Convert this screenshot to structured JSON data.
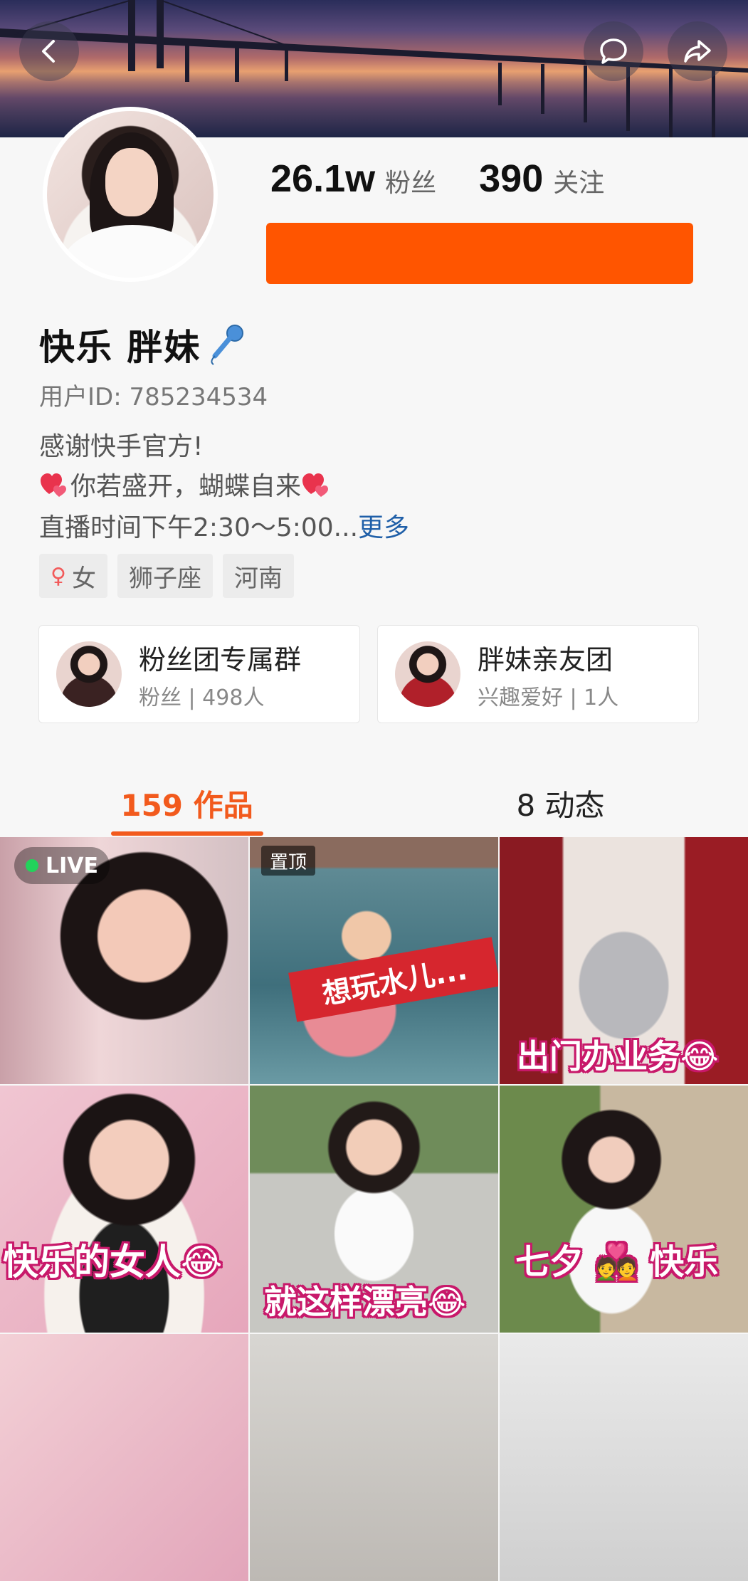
{
  "header": {
    "back_icon": "back-arrow-icon",
    "comment_icon": "speech-bubble-icon",
    "share_icon": "share-arrow-icon"
  },
  "stats": {
    "fans_value": "26.1w",
    "fans_label": "粉丝",
    "following_value": "390",
    "following_label": "关注"
  },
  "profile": {
    "name": "快乐 胖妹",
    "name_emoji": "microphone-icon",
    "user_id": "用户ID: 785234534",
    "bio_line1": "感谢快手官方!",
    "bio_line2": "你若盛开，蝴蝶自来",
    "bio_line3": "直播时间下午2:30～5:00...",
    "bio_more": "更多"
  },
  "tags": [
    {
      "label": "女",
      "icon": "female-icon"
    },
    {
      "label": "狮子座"
    },
    {
      "label": "河南"
    }
  ],
  "groups": [
    {
      "title": "粉丝团专属群",
      "subtitle": "粉丝 | 498人"
    },
    {
      "title": "胖妹亲友团",
      "subtitle": "兴趣爱好 | 1人"
    }
  ],
  "tabs": {
    "works": "159 作品",
    "moments": "8 动态"
  },
  "grid": {
    "live_badge": "LIVE",
    "pinned_badge": "置顶",
    "caption_2": "想玩水儿...",
    "caption_3": "出门办业务😂",
    "caption_4": "快乐的女人😂",
    "caption_5": "就这样漂亮😂",
    "caption_6": "七夕 💑 快乐"
  },
  "colors": {
    "accent": "#ff5500",
    "tab_active": "#f25a1d",
    "link": "#1f5fa8"
  }
}
